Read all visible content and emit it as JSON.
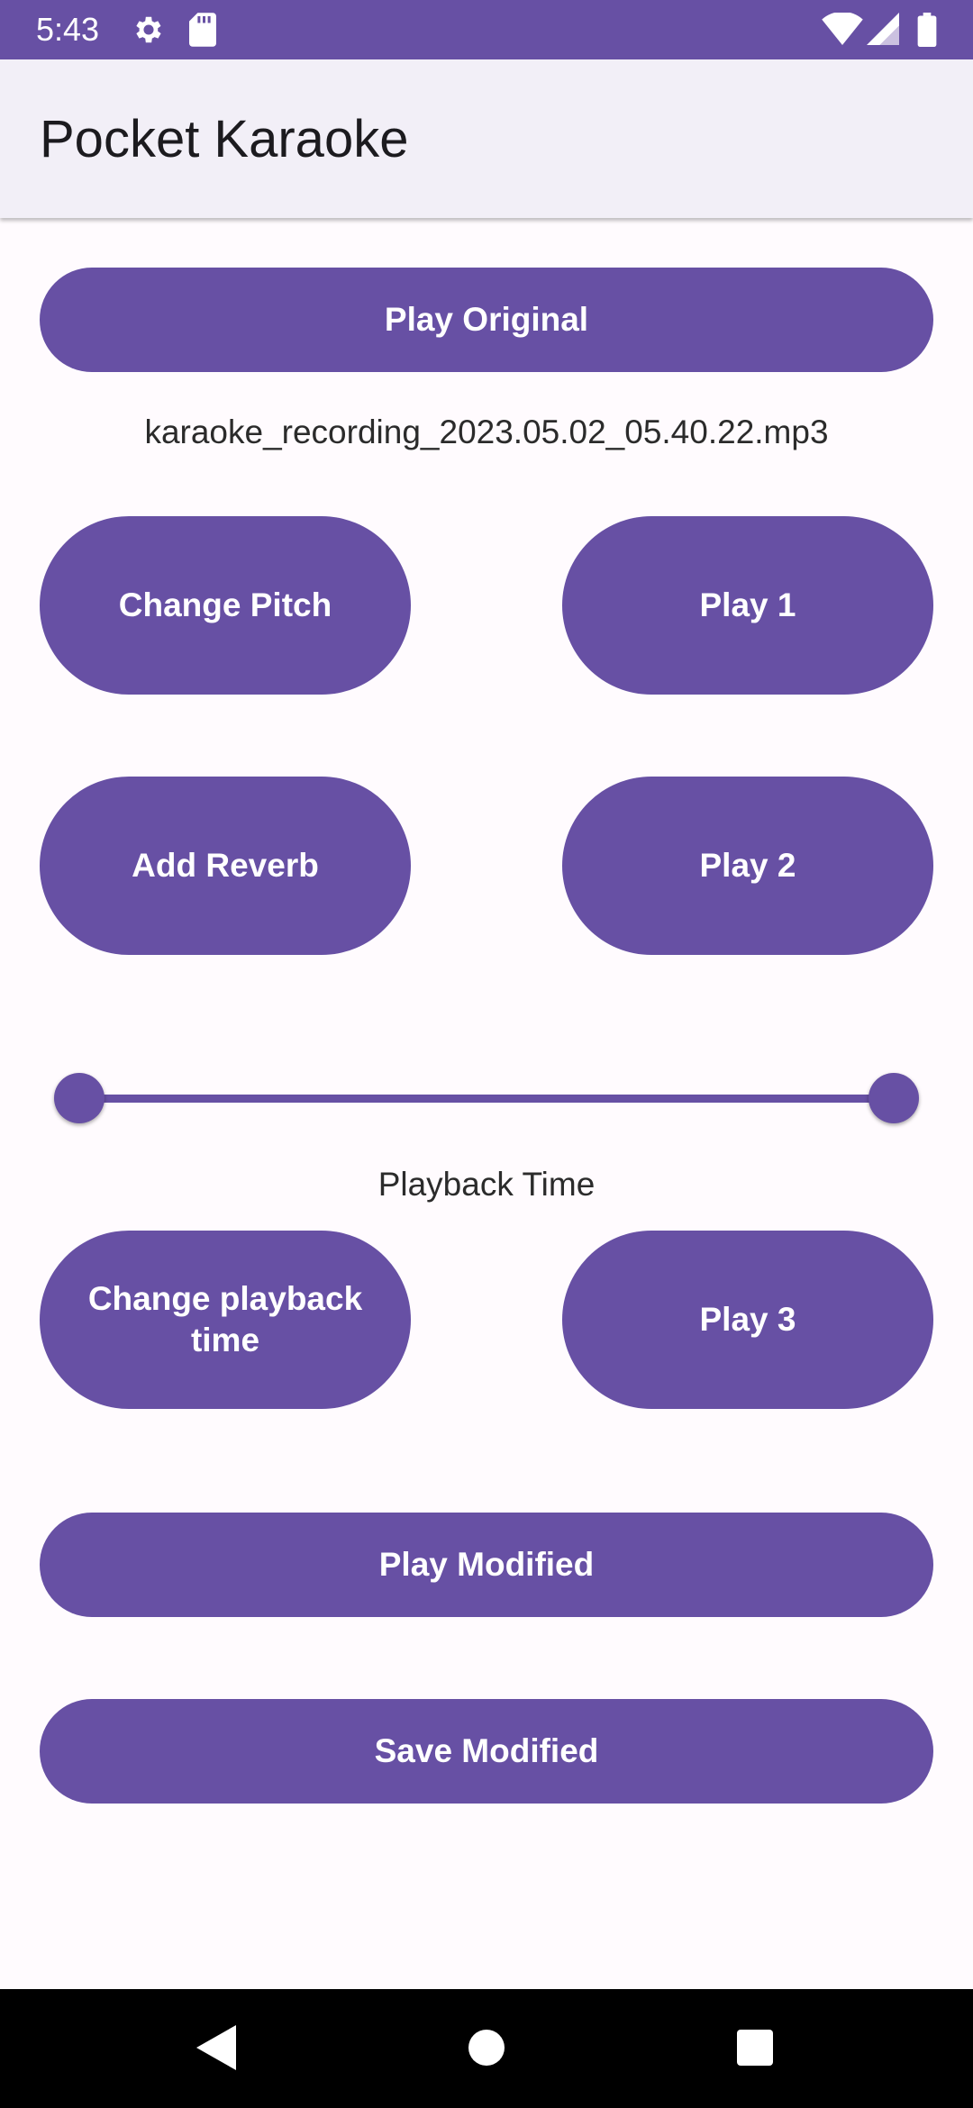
{
  "status_bar": {
    "time": "5:43",
    "icons": [
      "gear-icon",
      "sd-card-icon",
      "wifi-icon",
      "signal-icon",
      "battery-icon"
    ]
  },
  "app_bar": {
    "title": "Pocket Karaoke"
  },
  "main": {
    "play_original_label": "Play Original",
    "filename": "karaoke_recording_2023.05.02_05.40.22.mp3",
    "change_pitch_label": "Change Pitch",
    "play_1_label": "Play 1",
    "add_reverb_label": "Add Reverb",
    "play_2_label": "Play 2",
    "playback_slider": {
      "start": 0,
      "end": 1
    },
    "playback_time_label": "Playback Time",
    "change_playback_time_label": "Change playback time",
    "play_3_label": "Play 3",
    "play_modified_label": "Play Modified",
    "save_modified_label": "Save Modified"
  },
  "nav_bar": {
    "icons": [
      "back-icon",
      "home-icon",
      "recents-icon"
    ]
  },
  "colors": {
    "primary": "#6750a4",
    "app_bar_bg": "#f2eff7",
    "background": "#fffbfe"
  }
}
